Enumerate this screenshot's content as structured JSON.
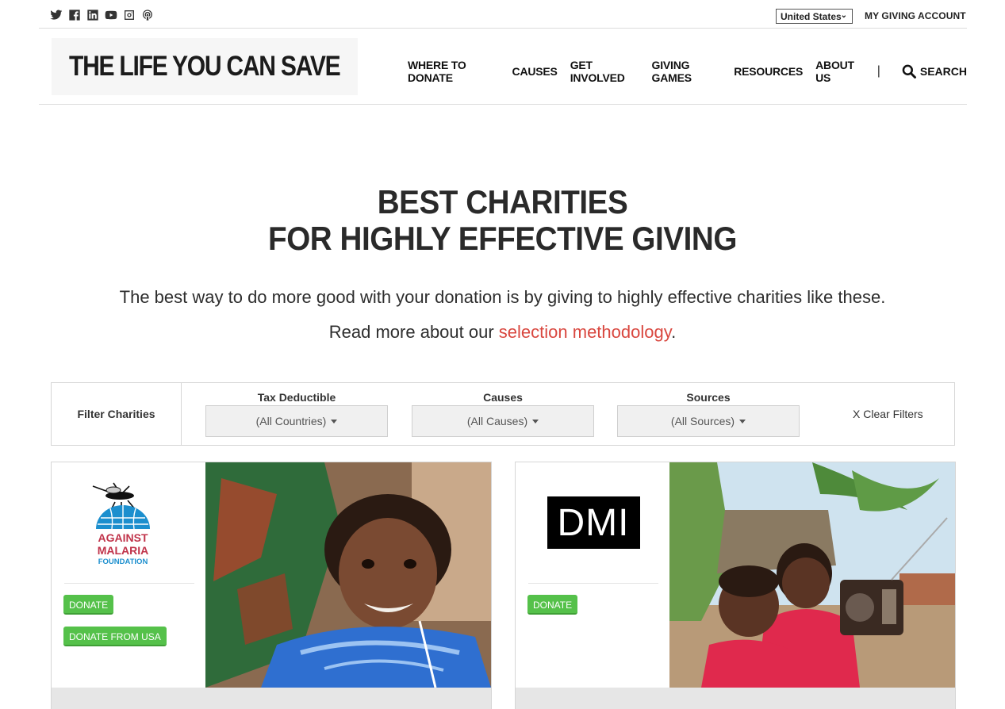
{
  "social": [
    "twitter-icon",
    "facebook-icon",
    "linkedin-icon",
    "youtube-icon",
    "instagram-icon",
    "podcast-icon"
  ],
  "topbar": {
    "country": "United States",
    "account": "MY GIVING ACCOUNT"
  },
  "brand": {
    "name": "THE LIFE YOU CAN SAVE",
    "heart_color": "#e0453d"
  },
  "nav": {
    "items": [
      "WHERE TO DONATE",
      "CAUSES",
      "GET INVOLVED",
      "GIVING GAMES",
      "RESOURCES",
      "ABOUT US"
    ],
    "separator": "|",
    "search": "SEARCH"
  },
  "hero": {
    "title_line1": "BEST CHARITIES",
    "title_line2": "FOR HIGHLY EFFECTIVE GIVING",
    "intro": "The best way to do more good with your donation is by giving to highly effective charities like these.",
    "readmore_prefix": "Read more about our ",
    "readmore_link": "selection methodology",
    "readmore_suffix": "."
  },
  "filters": {
    "label": "Filter Charities",
    "groups": [
      {
        "title": "Tax Deductible",
        "value": "(All Countries)"
      },
      {
        "title": "Causes",
        "value": "(All Causes)"
      },
      {
        "title": "Sources",
        "value": "(All Sources)"
      }
    ],
    "clear": "X Clear Filters"
  },
  "cards": [
    {
      "logo_line1": "AGAINST",
      "logo_line2": "MALARIA",
      "logo_line3": "FOUNDATION",
      "donate": "DONATE",
      "donate_usa": "DONATE FROM USA"
    },
    {
      "logo_text": "DMI",
      "donate": "DONATE"
    }
  ],
  "colors": {
    "accent_link": "#d9473f",
    "donate_green": "#55c14a"
  }
}
